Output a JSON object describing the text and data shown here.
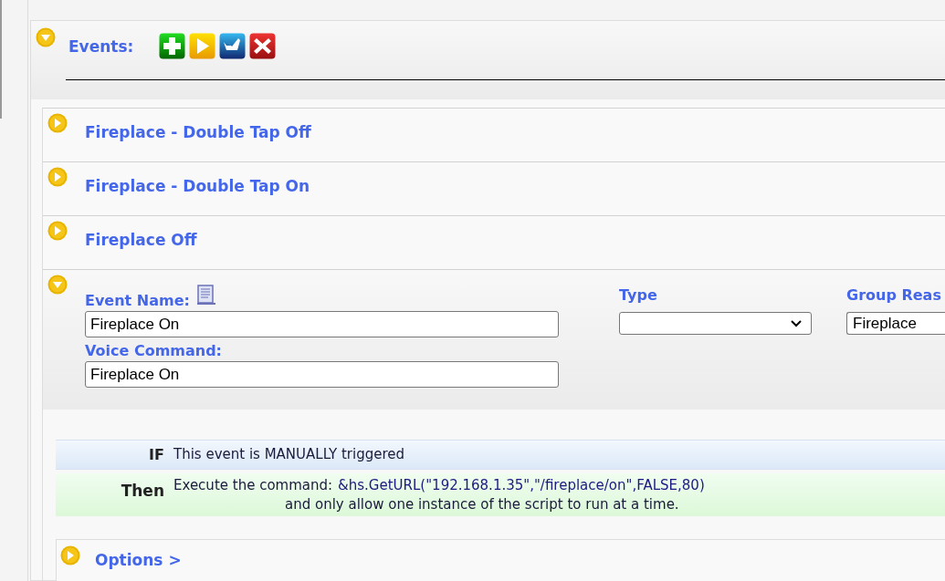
{
  "header": {
    "title": "Events:",
    "expanded": true,
    "toolbar": [
      {
        "kind": "add"
      },
      {
        "kind": "run"
      },
      {
        "kind": "import"
      },
      {
        "kind": "delete"
      }
    ]
  },
  "events": [
    {
      "title": "Fireplace - Double Tap Off",
      "expanded": false
    },
    {
      "title": "Fireplace - Double Tap On",
      "expanded": false
    },
    {
      "title": "Fireplace Off",
      "expanded": false
    },
    {
      "expanded": true,
      "event_name_label": "Event Name:",
      "event_name": "Fireplace On",
      "voice_command_label": "Voice Command:",
      "voice_command": "Fireplace On",
      "type_label": "Type",
      "group_label": "Group Reas",
      "group": "Fireplace",
      "if_label": "IF",
      "if_text": "This event is MANUALLY triggered",
      "then_label": "Then",
      "then_prefix": "Execute the command:",
      "then_command": "&hs.GetURL(\"192.168.1.35\",\"/fireplace/on\",FALSE,80)",
      "then_note": "and only allow one instance of the script to run at a time.",
      "options": {
        "title": "Options >",
        "expanded": false
      }
    }
  ]
}
